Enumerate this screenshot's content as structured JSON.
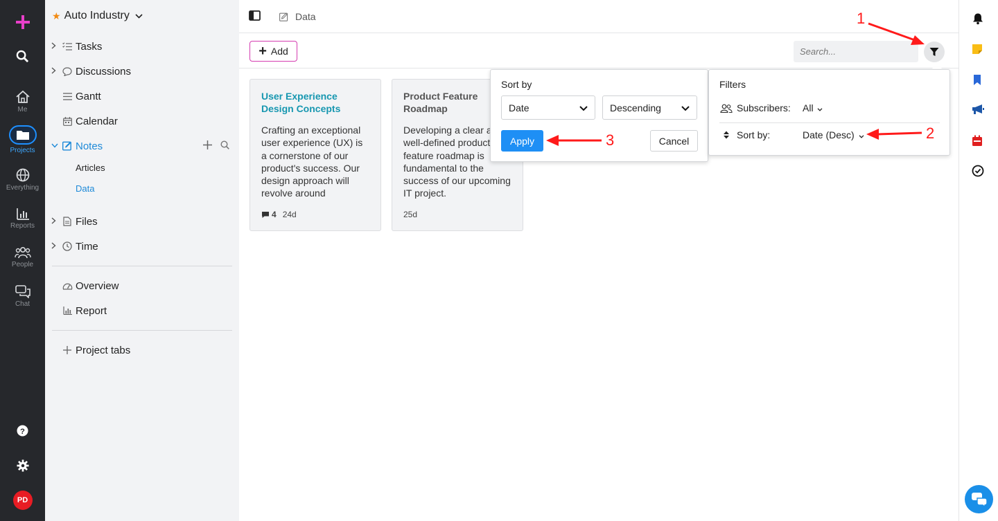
{
  "rail": {
    "items": [
      {
        "label": "Me",
        "icon": "home-icon"
      },
      {
        "label": "Projects",
        "icon": "folder-icon"
      },
      {
        "label": "Everything",
        "icon": "globe-icon"
      },
      {
        "label": "Reports",
        "icon": "bar-chart-icon"
      },
      {
        "label": "People",
        "icon": "people-icon"
      },
      {
        "label": "Chat",
        "icon": "chat-icon"
      }
    ],
    "avatar": "PD",
    "colors": {
      "background": "#26282c",
      "active": "#1e90ff",
      "create": "#e83fc9",
      "avatar": "#e81c24"
    }
  },
  "nav": {
    "project": "Auto Industry",
    "items": {
      "tasks": "Tasks",
      "discussions": "Discussions",
      "gantt": "Gantt",
      "calendar": "Calendar",
      "notes": "Notes",
      "articles": "Articles",
      "data": "Data",
      "files": "Files",
      "time": "Time",
      "overview": "Overview",
      "report": "Report",
      "project_tabs": "Project tabs"
    }
  },
  "topbar": {
    "breadcrumb": "Data"
  },
  "toolbar": {
    "add_label": "Add",
    "search_placeholder": "Search..."
  },
  "cards": [
    {
      "title": "User Experience Design Concepts",
      "description": "Crafting an exceptional user experience (UX) is a cornerstone of our product's success. Our design approach will revolve around",
      "comments": "4",
      "age": "24d"
    },
    {
      "title": "Product Feature Roadmap",
      "description": "Developing a clear and well-defined product feature roadmap is fundamental to the success of our upcoming IT project.",
      "comments": "",
      "age": "25d"
    }
  ],
  "sort_popover": {
    "heading": "Sort by",
    "field_value": "Date",
    "order_value": "Descending",
    "apply_label": "Apply",
    "cancel_label": "Cancel"
  },
  "filter_popover": {
    "heading": "Filters",
    "subscribers_label": "Subscribers:",
    "subscribers_value": "All",
    "sortby_label": "Sort by:",
    "sortby_value": "Date (Desc)"
  },
  "annotations": {
    "one": "1",
    "two": "2",
    "three": "3"
  },
  "colors": {
    "accent": "#1d89d8",
    "apply": "#1e8ff5",
    "add_border": "#d43bb0",
    "annotation": "#ff1a1a",
    "card_title_link": "#1797b0"
  }
}
